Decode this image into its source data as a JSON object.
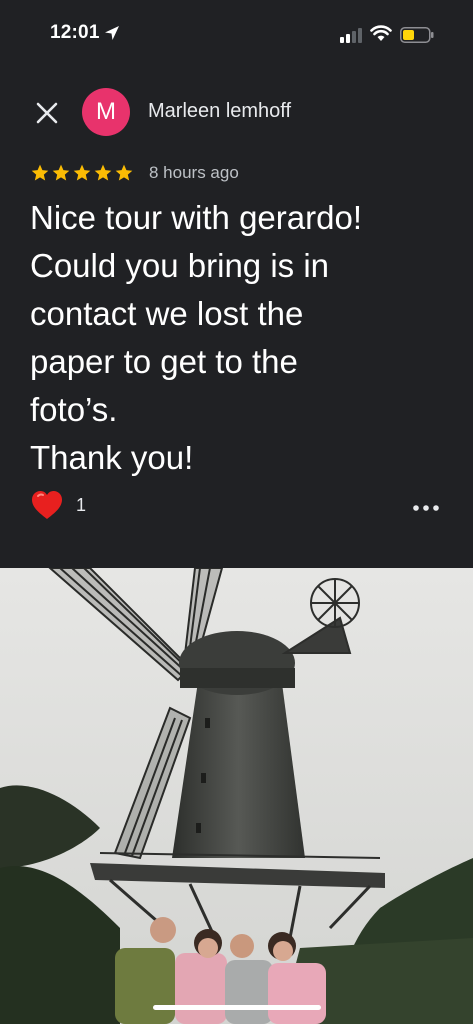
{
  "status_bar": {
    "time": "12:01",
    "icons": [
      "location-arrow-icon",
      "cellular-signal-icon",
      "wifi-icon",
      "battery-low-icon"
    ]
  },
  "header": {
    "close_icon": "close-icon",
    "avatar_letter": "M",
    "user_name": "Marleen lemhoff"
  },
  "review": {
    "rating": 5,
    "time_ago": "8 hours ago",
    "text": "Nice tour with gerardo!\nCould you bring is in\ncontact we lost the\npaper to get to the\nfoto’s.\nThank you!"
  },
  "reactions": {
    "icon": "heart-icon",
    "count": "1",
    "more_icon": "more-options-icon"
  },
  "photo": {
    "subject": "windmill-photo"
  },
  "colors": {
    "background": "#202124",
    "avatar": "#e8336c",
    "star": "#fbbc04",
    "battery": "#ffd60a"
  }
}
